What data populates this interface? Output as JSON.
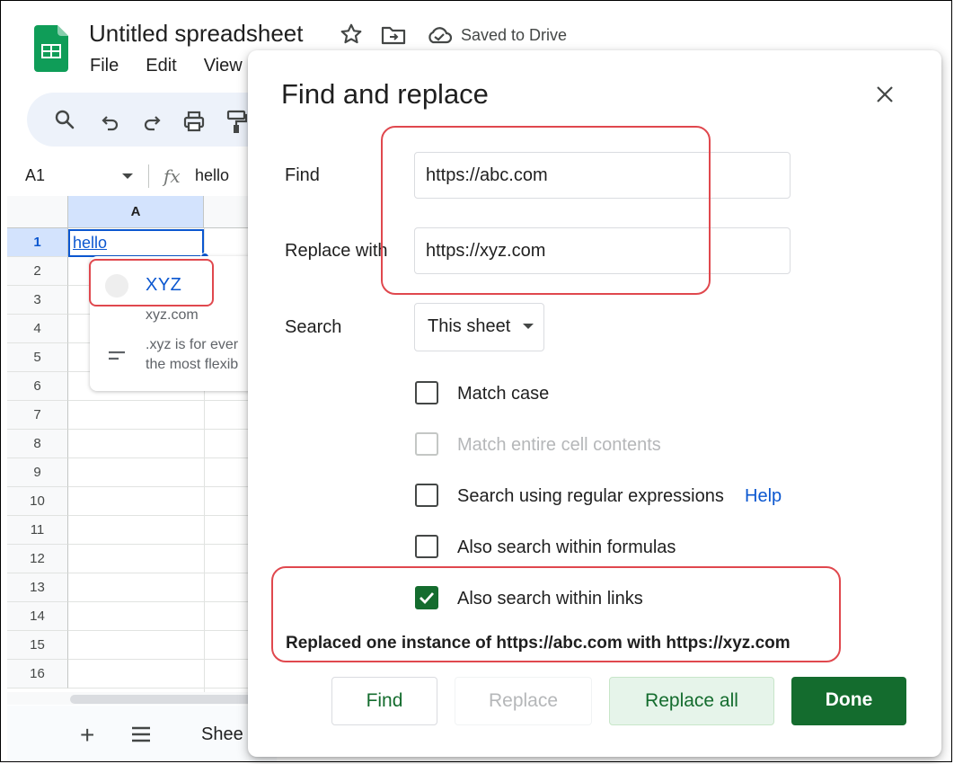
{
  "app": {
    "title": "Untitled spreadsheet",
    "saved_status": "Saved to Drive",
    "menu": [
      "File",
      "Edit",
      "View"
    ]
  },
  "formula_bar": {
    "name_box": "A1",
    "fx_label": "fx",
    "value": "hello"
  },
  "grid": {
    "column_header": "A",
    "rows": [
      "1",
      "2",
      "3",
      "4",
      "5",
      "6",
      "7",
      "8",
      "9",
      "10",
      "11",
      "12",
      "13",
      "14",
      "15",
      "16"
    ],
    "cell_a1": "hello"
  },
  "link_preview": {
    "title": "XYZ",
    "url": "xyz.com",
    "description_line1": ".xyz is for ever",
    "description_line2": "the most flexib"
  },
  "bottom_bar": {
    "add": "+",
    "sheet_label": "Shee"
  },
  "dialog": {
    "title": "Find and replace",
    "find_label": "Find",
    "find_value": "https://abc.com",
    "replace_label": "Replace with",
    "replace_value": "https://xyz.com",
    "search_label": "Search",
    "search_scope": "This sheet",
    "options": {
      "match_case": {
        "label": "Match case",
        "checked": false
      },
      "match_entire": {
        "label": "Match entire cell contents",
        "checked": false,
        "disabled": true
      },
      "regex": {
        "label": "Search using regular expressions",
        "checked": false
      },
      "help": "Help",
      "formulas": {
        "label": "Also search within formulas",
        "checked": false
      },
      "links": {
        "label": "Also search within links",
        "checked": true
      }
    },
    "status_message": "Replaced one instance of https://abc.com with https://xyz.com",
    "buttons": {
      "find": "Find",
      "replace": "Replace",
      "replace_all": "Replace all",
      "done": "Done"
    }
  },
  "colors": {
    "accent_green": "#146c2e",
    "link_blue": "#0b57d0",
    "highlight_red": "#e0484e",
    "sheets_green": "#0f9d58"
  }
}
